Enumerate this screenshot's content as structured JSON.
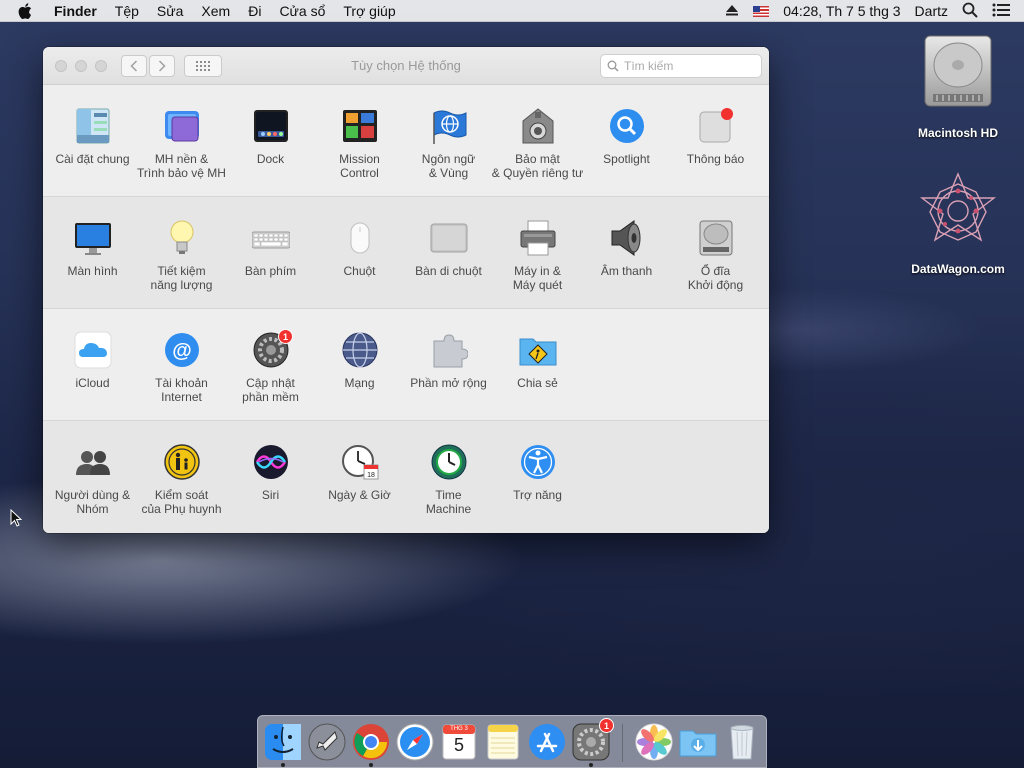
{
  "menubar": {
    "items": [
      "Finder",
      "Tệp",
      "Sửa",
      "Xem",
      "Đi",
      "Cửa sổ",
      "Trợ giúp"
    ],
    "clock": "04:28, Th 7 5 thg 3",
    "user": "Dartz"
  },
  "window": {
    "title": "Tùy chọn Hệ thống",
    "search_placeholder": "Tìm kiếm"
  },
  "sections": [
    {
      "panes": [
        {
          "line1": "Cài đặt chung",
          "line2": "",
          "icon": "general-icon"
        },
        {
          "line1": "MH nền &",
          "line2": "Trình bảo vệ MH",
          "icon": "desktop-screensaver-icon"
        },
        {
          "line1": "Dock",
          "line2": "",
          "icon": "dock-icon"
        },
        {
          "line1": "Mission",
          "line2": "Control",
          "icon": "mission-control-icon"
        },
        {
          "line1": "Ngôn ngữ",
          "line2": "& Vùng",
          "icon": "language-region-icon"
        },
        {
          "line1": "Bảo mật",
          "line2": "& Quyền riêng tư",
          "icon": "security-privacy-icon"
        },
        {
          "line1": "Spotlight",
          "line2": "",
          "icon": "spotlight-icon"
        },
        {
          "line1": "Thông báo",
          "line2": "",
          "icon": "notifications-icon"
        }
      ]
    },
    {
      "panes": [
        {
          "line1": "Màn hình",
          "line2": "",
          "icon": "displays-icon"
        },
        {
          "line1": "Tiết kiệm",
          "line2": "năng lượng",
          "icon": "energy-saver-icon"
        },
        {
          "line1": "Bàn phím",
          "line2": "",
          "icon": "keyboard-icon"
        },
        {
          "line1": "Chuột",
          "line2": "",
          "icon": "mouse-icon"
        },
        {
          "line1": "Bàn di chuột",
          "line2": "",
          "icon": "trackpad-icon"
        },
        {
          "line1": "Máy in &",
          "line2": "Máy quét",
          "icon": "printer-icon"
        },
        {
          "line1": "Âm thanh",
          "line2": "",
          "icon": "sound-icon"
        },
        {
          "line1": "Ổ đĩa",
          "line2": "Khởi động",
          "icon": "startup-disk-icon"
        }
      ]
    },
    {
      "panes": [
        {
          "line1": "iCloud",
          "line2": "",
          "icon": "icloud-icon"
        },
        {
          "line1": "Tài khoản",
          "line2": "Internet",
          "icon": "internet-accounts-icon"
        },
        {
          "line1": "Cập nhật",
          "line2": "phần mềm",
          "icon": "software-update-icon",
          "badge": "1"
        },
        {
          "line1": "Mạng",
          "line2": "",
          "icon": "network-icon"
        },
        {
          "line1": "Phần mở rộng",
          "line2": "",
          "icon": "extensions-icon"
        },
        {
          "line1": "Chia sẻ",
          "line2": "",
          "icon": "sharing-icon"
        }
      ]
    },
    {
      "panes": [
        {
          "line1": "Người dùng &",
          "line2": "Nhóm",
          "icon": "users-groups-icon"
        },
        {
          "line1": "Kiểm soát",
          "line2": "của Phụ huynh",
          "icon": "parental-controls-icon"
        },
        {
          "line1": "Siri",
          "line2": "",
          "icon": "siri-icon"
        },
        {
          "line1": "Ngày & Giờ",
          "line2": "",
          "icon": "date-time-icon"
        },
        {
          "line1": "Time",
          "line2": "Machine",
          "icon": "time-machine-icon"
        },
        {
          "line1": "Trợ năng",
          "line2": "",
          "icon": "accessibility-icon"
        }
      ]
    }
  ],
  "desktop": {
    "hd_label": "Macintosh HD",
    "site_label": "DataWagon.com"
  },
  "dock": {
    "calendar_month": "THG 3",
    "calendar_day": "5",
    "sysprefs_badge": "1"
  },
  "colors": {
    "badge": "#f2302e",
    "spotlight_blue": "#2d8ef0"
  }
}
